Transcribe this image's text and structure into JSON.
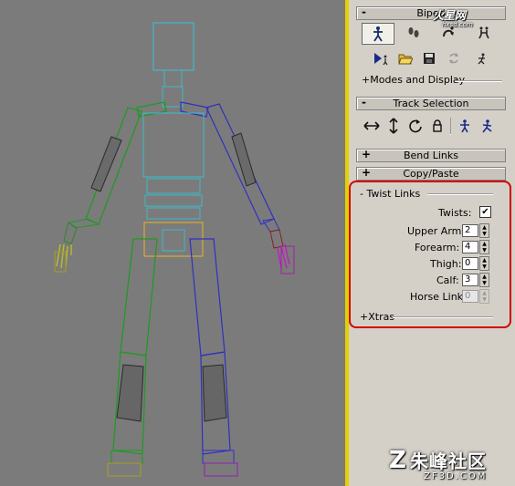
{
  "viewport": {
    "name": "biped-viewport"
  },
  "panel": {
    "biped": {
      "sign": "-",
      "title": "Biped"
    },
    "modes_display": "+Modes and Display",
    "track_selection": {
      "sign": "-",
      "title": "Track Selection"
    },
    "bend_links": {
      "sign": "+",
      "title": "Bend Links"
    },
    "copy_paste": {
      "sign": "+",
      "title": "Copy/Paste"
    },
    "twist_links": {
      "header": "- Twist Links",
      "twists_label": "Twists:",
      "twists_checked": true,
      "check_glyph": "✔",
      "upper_arm_label": "Upper Arm:",
      "upper_arm_value": "2",
      "forearm_label": "Forearm:",
      "forearm_value": "4",
      "thigh_label": "Thigh:",
      "thigh_value": "0",
      "calf_label": "Calf:",
      "calf_value": "3",
      "horse_link_label": "Horse Link:",
      "horse_link_value": "0"
    },
    "xtras": "+Xtras"
  },
  "watermark": {
    "top_text": "火星网",
    "top_sub": "hxsd.com",
    "bottom_cn": "朱峰社区",
    "bottom_en": "ZF3D.COM",
    "logo": "Z"
  },
  "colors": {
    "highlight": "#d40000",
    "viewport_bg": "#7b7b7b",
    "panel_bg": "#d4d0c8",
    "spine_cyan": "#3fb8c8",
    "left_limb_green": "#1f9a1f",
    "right_limb_blue": "#3030c0",
    "pelvis_yellow": "#e0b030"
  }
}
